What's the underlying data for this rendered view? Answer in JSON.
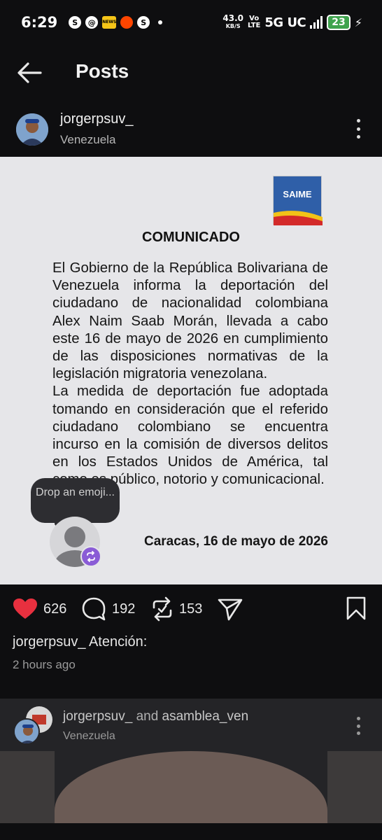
{
  "status_bar": {
    "time": "6:29",
    "app_icons": [
      "S",
      "@",
      "NEWS",
      "reddit",
      "S"
    ],
    "net_speed": "43.0",
    "net_unit": "KB/S",
    "volte_top": "Vo",
    "volte_bottom": "LTE",
    "network": "5G UC",
    "battery": "23"
  },
  "header": {
    "title": "Posts"
  },
  "post": {
    "username": "jorgerpsuv_",
    "location": "Venezuela",
    "image": {
      "logo_text": "SAIME",
      "title": "COMUNICADO",
      "paragraph1": "El Gobierno de la República Bolivariana de Venezuela informa la deportación del ciudadano de nacionalidad colombiana Alex Naim Saab Morán, llevada a cabo este 16 de mayo de 2026 en cumplimiento de las disposiciones normativas de la legislación migratoria venezolana.",
      "paragraph2": "La medida de deportación fue adoptada tomando en consideración que el referido ciudadano colombiano se encuentra incurso en la comisión de diversos delitos en los Estados Unidos de América, tal como es público, notorio y comunicacional.",
      "date_line": "Caracas, 16 de mayo de 2026"
    },
    "emoji_drop": {
      "label": "Drop an emoji..."
    },
    "likes": "626",
    "comments": "192",
    "reposts": "153",
    "caption_user": "jorgerpsuv_",
    "caption_text": "Atención:",
    "timestamp": "2 hours ago"
  },
  "next_post": {
    "user1": "jorgerpsuv_",
    "joiner": "and",
    "user2": "asamblea_ven",
    "location": "Venezuela"
  },
  "colors": {
    "like_red": "#e8303f",
    "background": "#0e0e10",
    "document_bg": "#e6e6e9",
    "repost_badge": "#8a5cd6"
  }
}
